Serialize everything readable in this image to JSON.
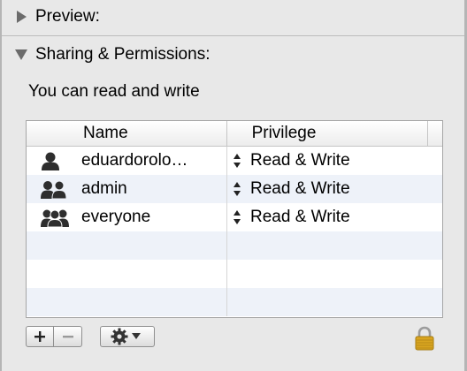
{
  "sections": {
    "preview": {
      "title": "Preview:",
      "expanded": false
    },
    "sharing": {
      "title": "Sharing & Permissions:",
      "expanded": true
    }
  },
  "status_text": "You can read and write",
  "table": {
    "columns": {
      "name": "Name",
      "privilege": "Privilege"
    },
    "rows": [
      {
        "name": "eduardorolo…",
        "privilege": "Read & Write",
        "icon": "single-user-icon"
      },
      {
        "name": "admin",
        "privilege": "Read & Write",
        "icon": "user-group-icon"
      },
      {
        "name": "everyone",
        "privilege": "Read & Write",
        "icon": "everyone-group-icon"
      }
    ]
  },
  "toolbar": {
    "add_label": "+",
    "remove_label": "−"
  },
  "colors": {
    "background": "#e8e8e8",
    "row_alt": "#eef2f9",
    "lock_gold": "#d9a520"
  }
}
